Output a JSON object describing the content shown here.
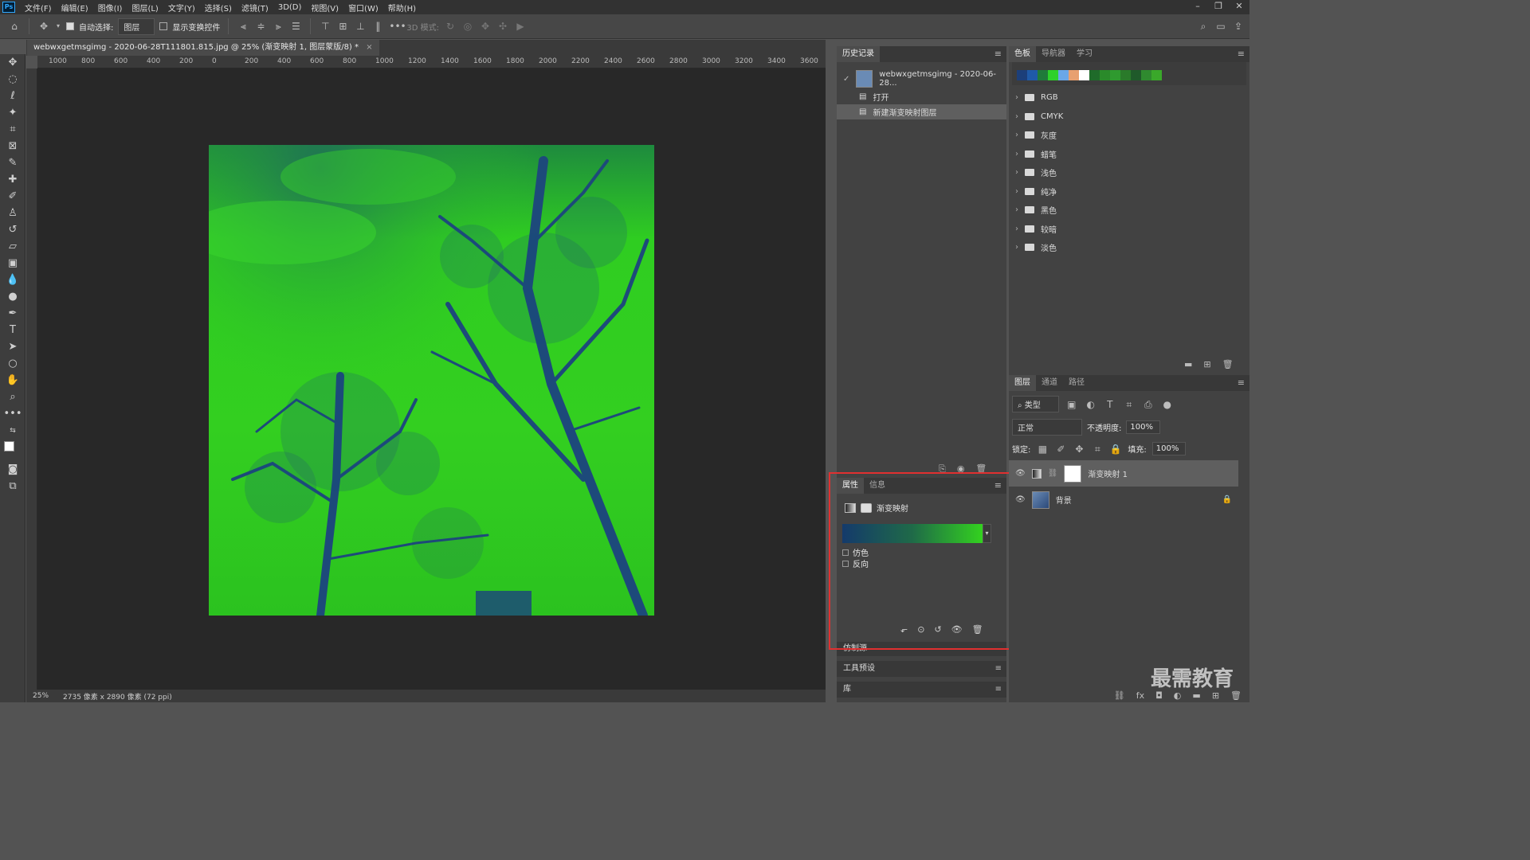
{
  "app": {
    "logo": "Ps"
  },
  "menu": [
    "文件(F)",
    "编辑(E)",
    "图像(I)",
    "图层(L)",
    "文字(Y)",
    "选择(S)",
    "滤镜(T)",
    "3D(D)",
    "视图(V)",
    "窗口(W)",
    "帮助(H)"
  ],
  "options": {
    "auto_select_label": "自动选择:",
    "auto_select_value": "图层",
    "show_transform_label": "显示变换控件",
    "mode_3d_label": "3D 模式:"
  },
  "document": {
    "tab_title": "webwxgetmsgimg - 2020-06-28T111801.815.jpg @ 25% (渐变映射 1, 图层蒙版/8) *",
    "zoom": "25%",
    "info": "2735 像素 x 2890 像素 (72 ppi)",
    "ruler_ticks": [
      "1000",
      "800",
      "600",
      "400",
      "200",
      "0",
      "200",
      "400",
      "600",
      "800",
      "1000",
      "1200",
      "1400",
      "1600",
      "1800",
      "2000",
      "2200",
      "2400",
      "2600",
      "2800",
      "3000",
      "3200",
      "3400",
      "3600"
    ]
  },
  "history": {
    "tab": "历史记录",
    "snapshot": "webwxgetmsgimg - 2020-06-28...",
    "items": [
      "打开",
      "新建渐变映射图层"
    ]
  },
  "properties": {
    "tabs": [
      "属性",
      "信息"
    ],
    "title": "渐变映射",
    "dither_label": "仿色",
    "reverse_label": "反向",
    "gradient": {
      "start": "#143a6b",
      "end": "#33d21f"
    }
  },
  "lower_panels": {
    "clone": "仿制源",
    "presets": "工具预设",
    "library": "库"
  },
  "swatches": {
    "tabs": [
      "色板",
      "导航器",
      "学习"
    ],
    "colors": [
      "#1c3f7a",
      "#1f5aa8",
      "#1f7a3a",
      "#2ed12a",
      "#6aa7e8",
      "#e8a070",
      "#ffffff",
      "#1f6b2a",
      "#2a8a2a",
      "#2f9a2f",
      "#2a7a2a",
      "#1f5a2a",
      "#2f8a2f",
      "#3aa82a"
    ],
    "folders": [
      "RGB",
      "CMYK",
      "灰度",
      "蜡笔",
      "浅色",
      "纯净",
      "黑色",
      "较暗",
      "淡色"
    ]
  },
  "layers": {
    "tabs": [
      "图层",
      "通道",
      "路径"
    ],
    "filter": "类型",
    "blend_mode": "正常",
    "opacity_label": "不透明度:",
    "opacity": "100%",
    "lock_label": "锁定:",
    "fill_label": "填充:",
    "fill": "100%",
    "items": [
      {
        "name": "渐变映射 1",
        "selected": true
      },
      {
        "name": "背景",
        "selected": false
      }
    ]
  },
  "watermark": "最需教育"
}
